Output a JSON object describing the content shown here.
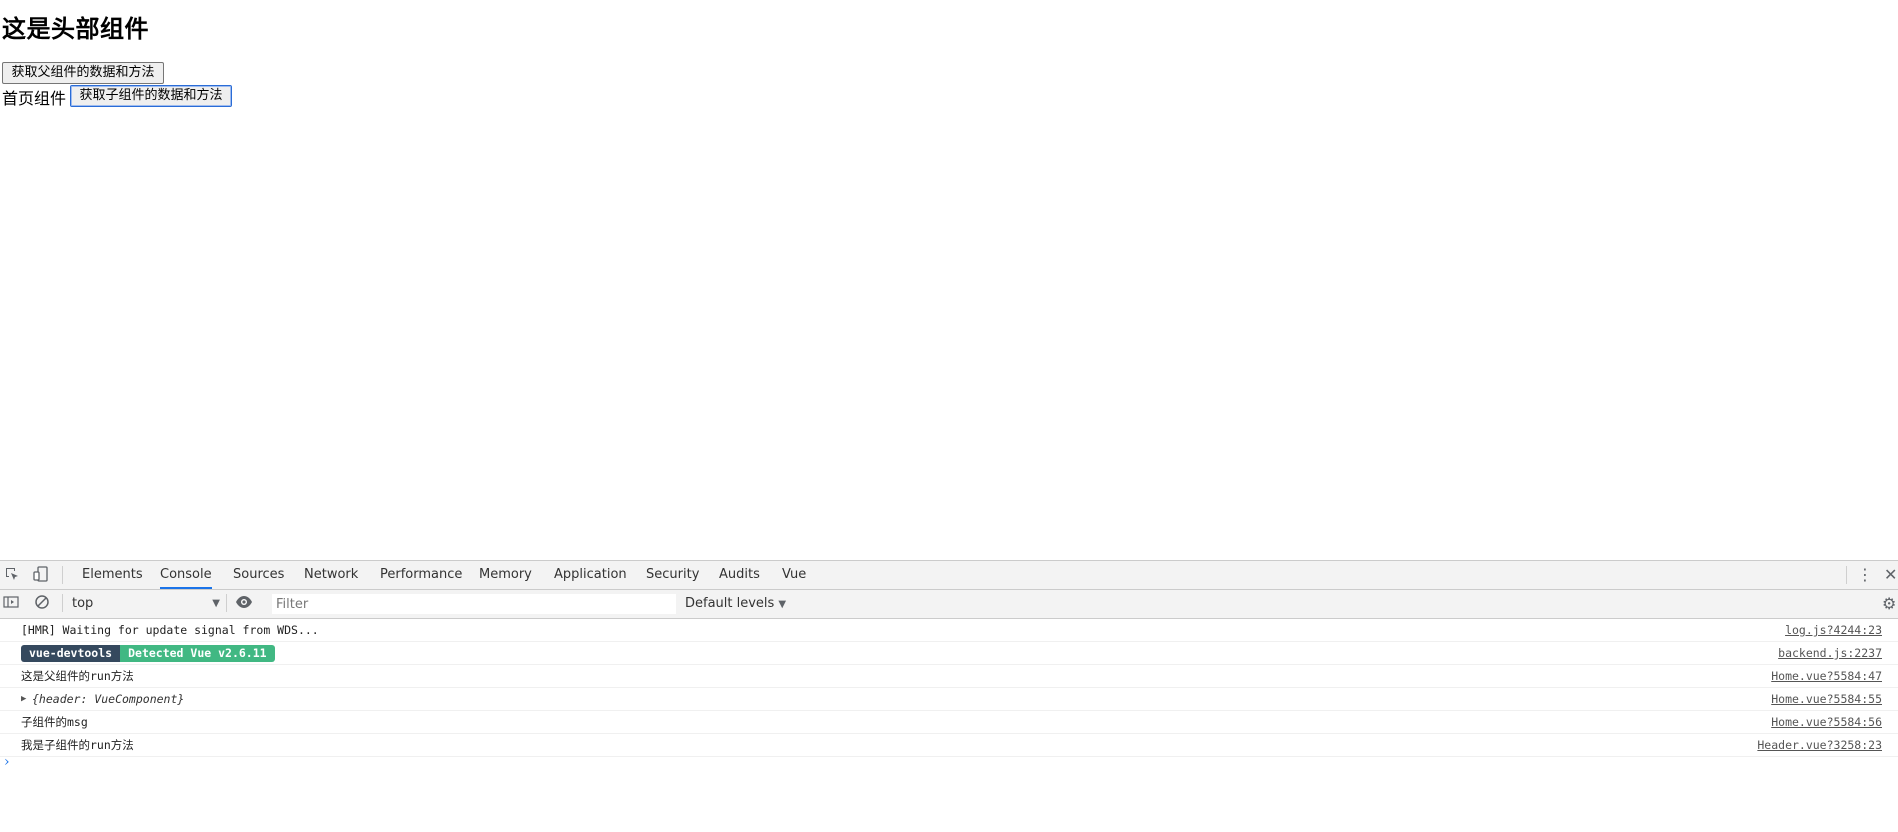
{
  "page": {
    "title": "这是头部组件",
    "parent_button": "获取父组件的数据和方法",
    "home_label": "首页组件",
    "child_button": "获取子组件的数据和方法"
  },
  "devtools": {
    "tabs": [
      "Elements",
      "Console",
      "Sources",
      "Network",
      "Performance",
      "Memory",
      "Application",
      "Security",
      "Audits",
      "Vue"
    ],
    "active_tab": "Console",
    "context": "top",
    "filter_placeholder": "Filter",
    "levels": "Default levels",
    "accent": "#1a73e8",
    "icons": {
      "inspect": "inspect-icon",
      "device": "device-toggle-icon",
      "sidebar": "sidebar-toggle-icon",
      "clear": "clear-console-icon",
      "eye": "live-expression-icon",
      "more": "kebab-menu-icon",
      "close": "close-icon",
      "settings": "gear-icon"
    }
  },
  "console": {
    "rows": [
      {
        "text": "[HMR] Waiting for update signal from WDS...",
        "source": "log.js?4244:23"
      },
      {
        "badge_left": "vue-devtools",
        "badge_right": "Detected Vue v2.6.11",
        "source": "backend.js:2237",
        "badge_left_color": "#35495e",
        "badge_right_color": "#41b883"
      },
      {
        "text": "这是父组件的run方法",
        "source": "Home.vue?5584:47"
      },
      {
        "text": "{header: VueComponent}",
        "source": "Home.vue?5584:55"
      },
      {
        "text": "子组件的msg",
        "source": "Home.vue?5584:56"
      },
      {
        "text": "我是子组件的run方法",
        "source": "Header.vue?3258:23"
      }
    ],
    "prompt": "›"
  }
}
